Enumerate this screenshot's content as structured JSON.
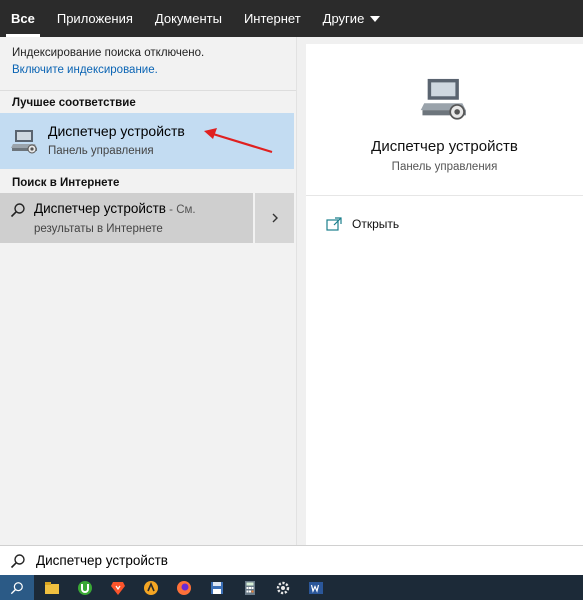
{
  "tabs": [
    {
      "label": "Все",
      "active": true
    },
    {
      "label": "Приложения"
    },
    {
      "label": "Документы"
    },
    {
      "label": "Интернет"
    },
    {
      "label": "Другие"
    }
  ],
  "notice": {
    "text": "Индексирование поиска отключено.",
    "link": "Включите индексирование."
  },
  "best_match": {
    "header": "Лучшее соответствие",
    "title": "Диспетчер устройств",
    "subtitle": "Панель управления",
    "icon": "device-manager-icon"
  },
  "web": {
    "header": "Поиск в Интернете",
    "title": "Диспетчер устройств",
    "suffix": " - См.",
    "subtitle": "результаты в Интернете"
  },
  "preview": {
    "title": "Диспетчер устройств",
    "subtitle": "Панель управления",
    "actions": [
      {
        "label": "Открыть",
        "icon": "open-icon"
      }
    ]
  },
  "search": {
    "value": "Диспетчер устройств"
  },
  "taskbar": {
    "items": [
      "search-icon",
      "file-explorer-icon",
      "utorrent-icon",
      "brave-icon",
      "avast-icon",
      "firefox-icon",
      "save-icon",
      "calculator-icon",
      "settings-icon",
      "word-icon"
    ]
  },
  "colors": {
    "tabbar": "#2b2b2b",
    "highlight": "#c3dcf2",
    "link": "#0a64b4",
    "annotation_arrow": "#e02020",
    "taskbar": "#1c2a38"
  }
}
